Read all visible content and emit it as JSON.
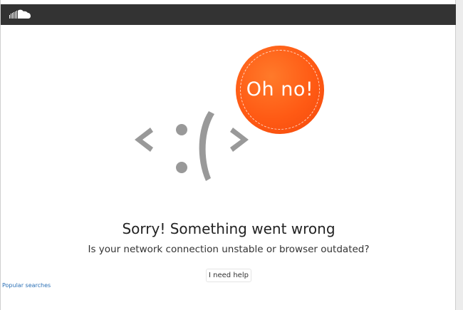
{
  "header": {
    "logo_icon": "soundcloud-cloud-icon"
  },
  "error": {
    "badge_text": "Oh no!",
    "face_icon": "sad-face-code-icon",
    "title": "Sorry! Something went wrong",
    "subtitle": "Is your network connection unstable or browser outdated?",
    "help_button_label": "I need help"
  },
  "footer": {
    "popular_searches_label": "Popular searches"
  },
  "colors": {
    "header_bg": "#333333",
    "badge": "#ff5a14",
    "glyph": "#999999",
    "link": "#2a6fb5"
  }
}
